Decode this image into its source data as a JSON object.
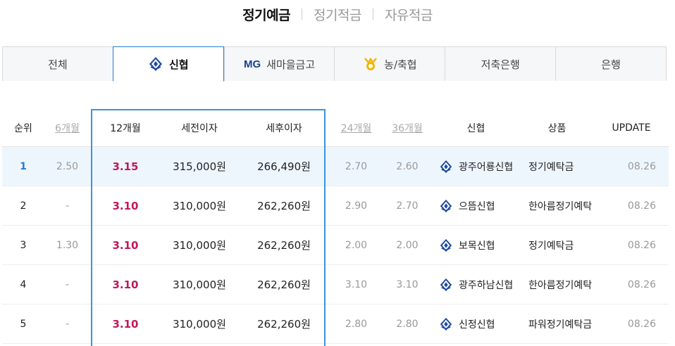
{
  "top_tabs": [
    {
      "label": "정기예금",
      "active": true
    },
    {
      "label": "정기적금",
      "active": false
    },
    {
      "label": "자유적금",
      "active": false
    }
  ],
  "institution_tabs": [
    {
      "label": "전체",
      "icon": "none",
      "active": false
    },
    {
      "label": "신협",
      "icon": "shinhyup-logo-icon",
      "active": true
    },
    {
      "label": "새마을금고",
      "prefix": "MG",
      "icon": "mg-logo",
      "active": false
    },
    {
      "label": "농/축협",
      "icon": "nh-logo-icon",
      "active": false
    },
    {
      "label": "저축은행",
      "icon": "none",
      "active": false
    },
    {
      "label": "은행",
      "icon": "none",
      "active": false
    }
  ],
  "table": {
    "headers": {
      "rank": "순위",
      "m6": "6개월",
      "m12": "12개월",
      "pre_tax": "세전이자",
      "post_tax": "세후이자",
      "m24": "24개월",
      "m36": "36개월",
      "institution": "신협",
      "product": "상품",
      "update": "UPDATE"
    },
    "rows": [
      {
        "rank": "1",
        "m6": "2.50",
        "m12": "3.15",
        "pre_tax": "315,000원",
        "post_tax": "266,490원",
        "m24": "2.70",
        "m36": "2.60",
        "institution": "광주어룡신협",
        "product": "정기예탁금",
        "update": "08.26"
      },
      {
        "rank": "2",
        "m6": "-",
        "m12": "3.10",
        "pre_tax": "310,000원",
        "post_tax": "262,260원",
        "m24": "2.90",
        "m36": "2.70",
        "institution": "으뜸신협",
        "product": "한아름정기예탁",
        "update": "08.26"
      },
      {
        "rank": "3",
        "m6": "1.30",
        "m12": "3.10",
        "pre_tax": "310,000원",
        "post_tax": "262,260원",
        "m24": "2.00",
        "m36": "2.00",
        "institution": "보목신협",
        "product": "정기예탁금",
        "update": "08.26"
      },
      {
        "rank": "4",
        "m6": "-",
        "m12": "3.10",
        "pre_tax": "310,000원",
        "post_tax": "262,260원",
        "m24": "3.10",
        "m36": "3.10",
        "institution": "광주하남신협",
        "product": "한아름정기예탁",
        "update": "08.26"
      },
      {
        "rank": "5",
        "m6": "-",
        "m12": "3.10",
        "pre_tax": "310,000원",
        "post_tax": "262,260원",
        "m24": "2.80",
        "m36": "2.80",
        "institution": "신정신협",
        "product": "파워정기예탁금",
        "update": "08.26"
      }
    ]
  },
  "colors": {
    "accent_blue": "#1f7fd4",
    "rate_red": "#c0185c",
    "shinhyup_navy": "#1d4aa0",
    "nh_yellow": "#f4b400"
  }
}
